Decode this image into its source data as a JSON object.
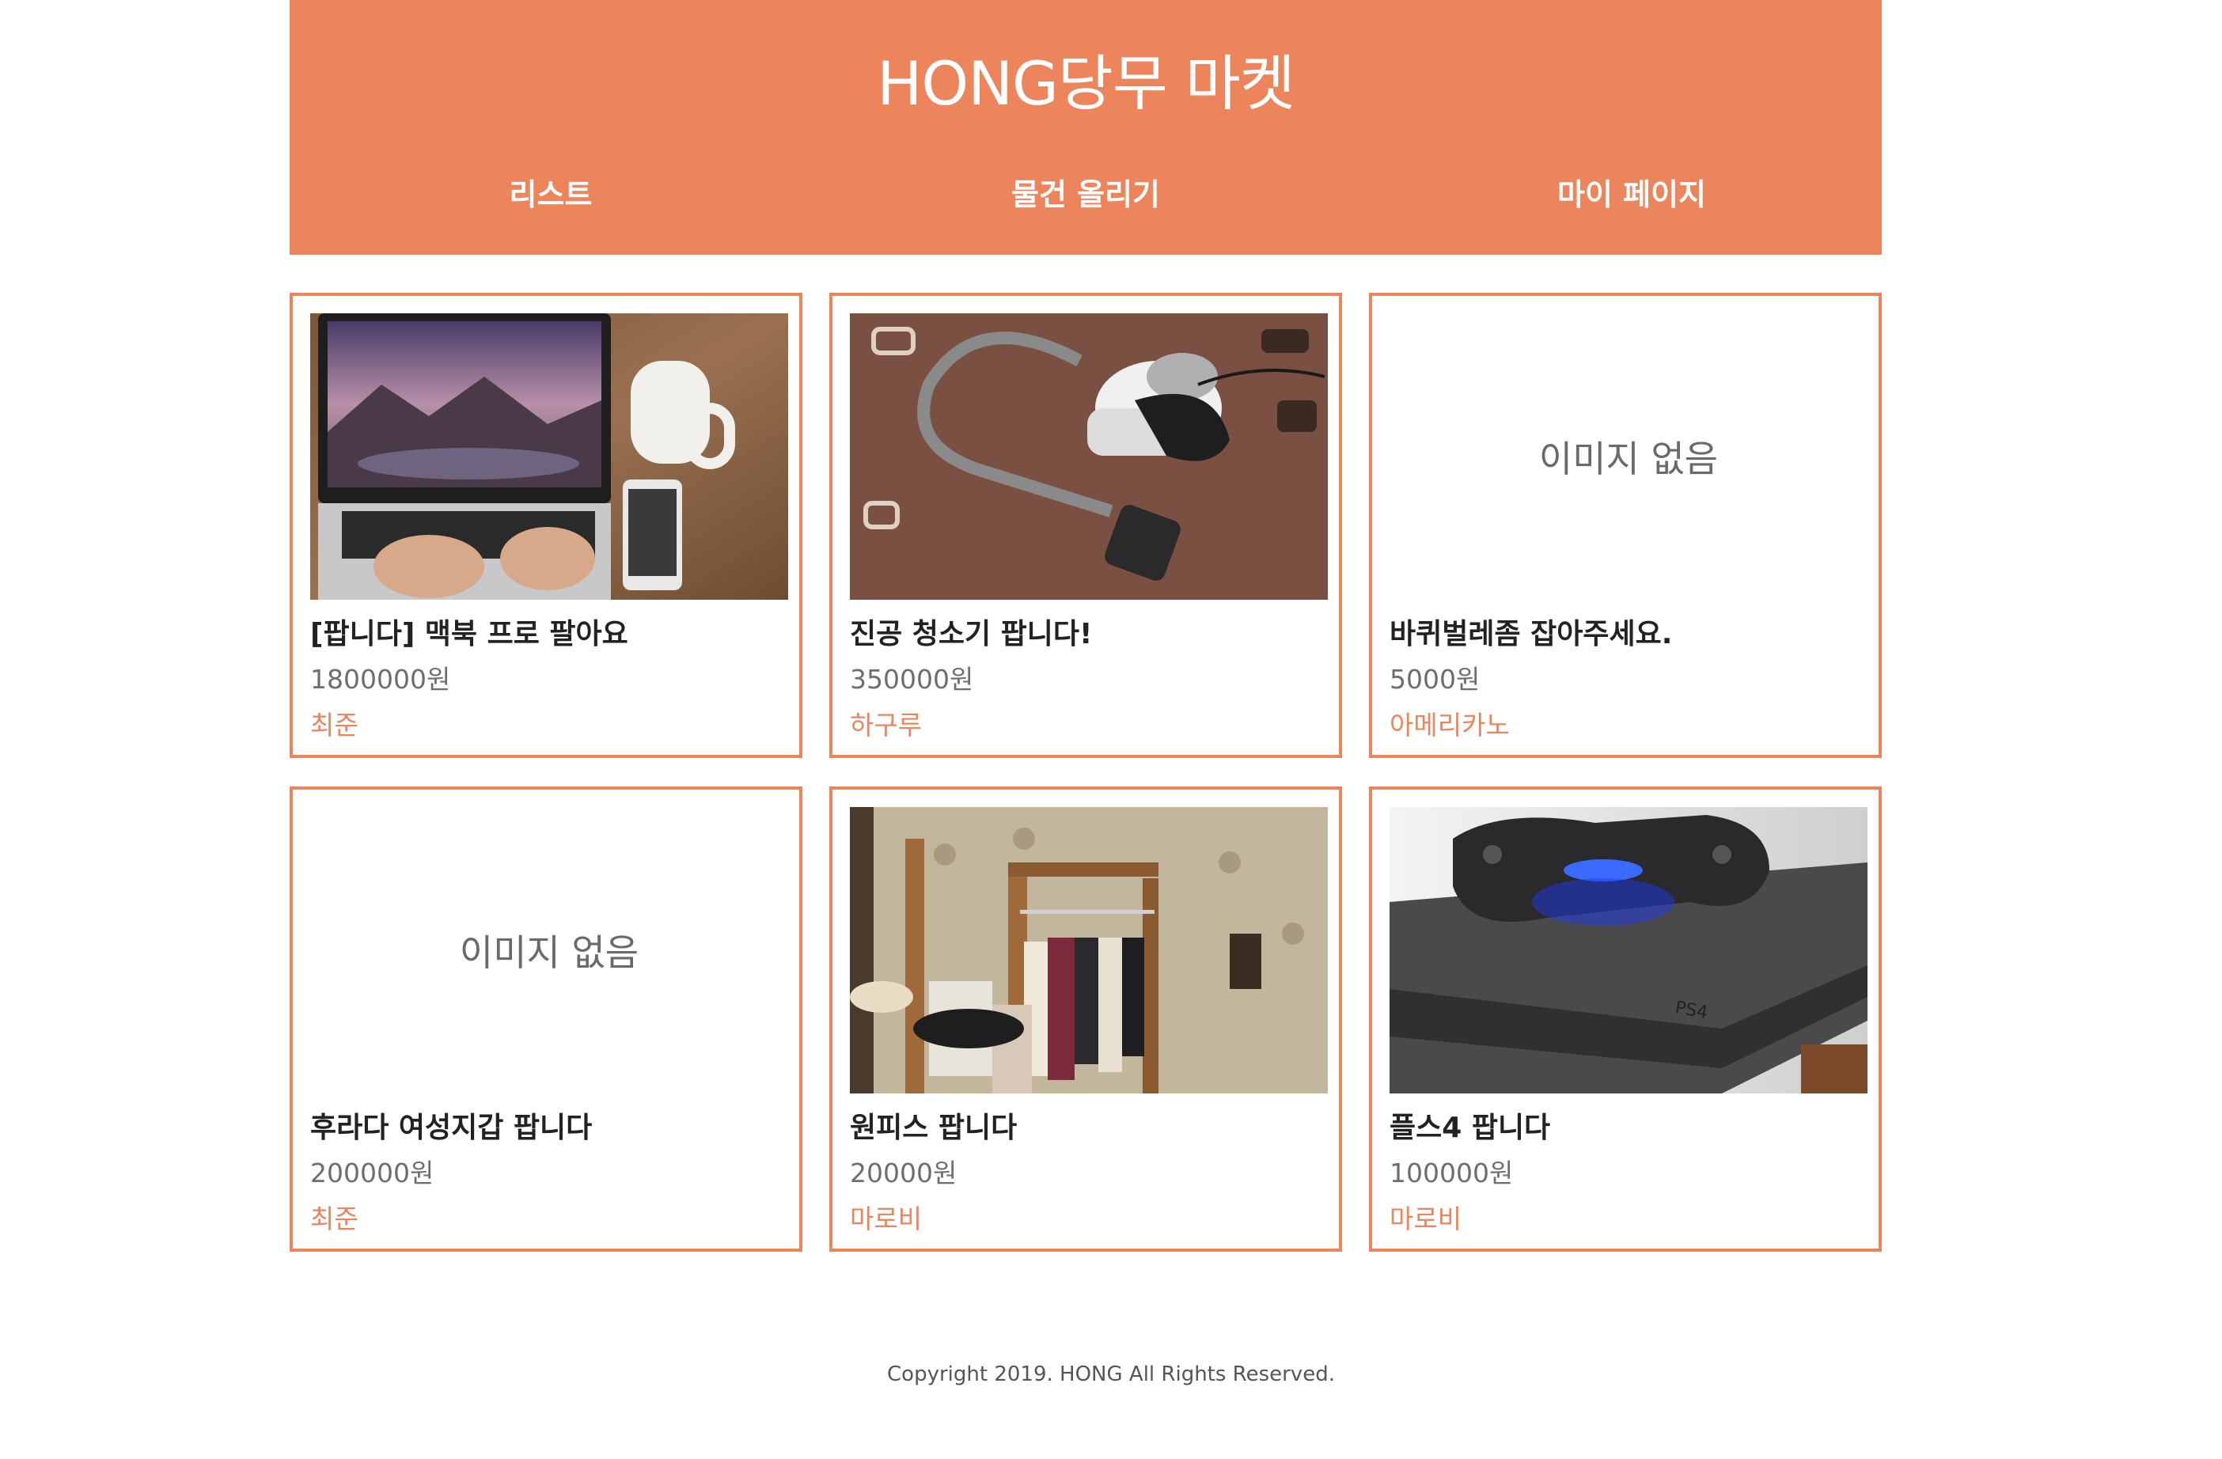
{
  "header": {
    "title": "HONG당무 마켓",
    "nav": [
      {
        "label": "리스트"
      },
      {
        "label": "물건 올리기"
      },
      {
        "label": "마이 페이지"
      }
    ]
  },
  "products": [
    {
      "title": "[팝니다] 맥북 프로 팔아요",
      "price": "1800000원",
      "seller": "최준",
      "image": "laptop-photo"
    },
    {
      "title": "진공 청소기 팝니다!",
      "price": "350000원",
      "seller": "하구루",
      "image": "vacuum-photo"
    },
    {
      "title": "바퀴벌레좀 잡아주세요.",
      "price": "5000원",
      "seller": "아메리카노",
      "image": null,
      "no_image_text": "이미지 없음"
    },
    {
      "title": "후라다 여성지갑 팝니다",
      "price": "200000원",
      "seller": "최준",
      "image": null,
      "no_image_text": "이미지 없음"
    },
    {
      "title": "원피스 팝니다",
      "price": "20000원",
      "seller": "마로비",
      "image": "clothes-rack-photo"
    },
    {
      "title": "플스4 팝니다",
      "price": "100000원",
      "seller": "마로비",
      "image": "ps4-photo"
    }
  ],
  "footer": {
    "copyright": "Copyright 2019. HONG All Rights Reserved."
  },
  "colors": {
    "accent": "#ed855c",
    "text_dark": "#222222",
    "text_muted": "#6e6e6e"
  }
}
